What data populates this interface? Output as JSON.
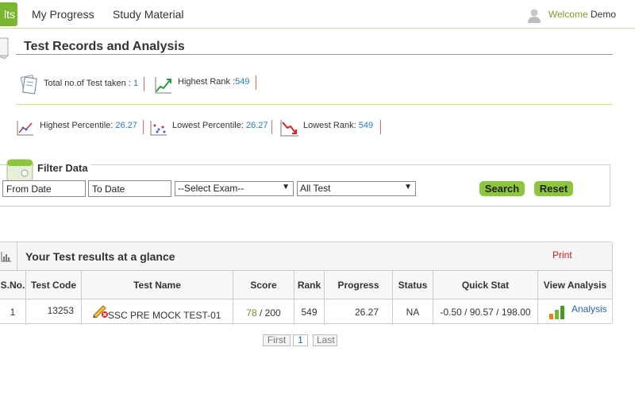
{
  "nav": {
    "active_tab": "lts",
    "tabs": [
      "My Progress",
      "Study Material"
    ],
    "welcome_label": "Welcome",
    "user_name": "Demo"
  },
  "section": {
    "title": "Test Records and Analysis"
  },
  "stats": {
    "total_tests_label": "Total no.of Test taken :",
    "total_tests_value": "1",
    "highest_rank_label": "Highest Rank :",
    "highest_rank_value": "549",
    "highest_percentile_label": "Highest Percentile:",
    "highest_percentile_value": "26.27",
    "lowest_percentile_label": "Lowest Percentile:",
    "lowest_percentile_value": "26.27",
    "lowest_rank_label": "Lowest Rank:",
    "lowest_rank_value": "549"
  },
  "filter": {
    "title": "Filter Data",
    "from_date": "From Date",
    "to_date": "To Date",
    "exam_select": "--Select Exam--",
    "test_select": "All Test",
    "search_label": "Search",
    "reset_label": "Reset"
  },
  "results": {
    "title": "Your Test results at a glance",
    "print_label": "Print",
    "columns": [
      "S.No.",
      "Test Code",
      "Test Name",
      "Score",
      "Rank",
      "Progress",
      "Status",
      "Quick Stat",
      "View Analysis"
    ],
    "rows": [
      {
        "sno": "1",
        "code": "13253",
        "name": "SSC PRE MOCK TEST-01",
        "score": "78",
        "score_total": "/ 200",
        "rank": "549",
        "progress": "26.27",
        "status": "NA",
        "quick_stat": "-0.50 / 90.57 / 198.00",
        "analysis_label": "Analysis"
      }
    ]
  },
  "pagination": {
    "first": "First",
    "current": "1",
    "last": "Last"
  },
  "colors": {
    "accent_green": "#8cc63f",
    "link_blue": "#2a7ab8",
    "print_red": "#b22222"
  }
}
